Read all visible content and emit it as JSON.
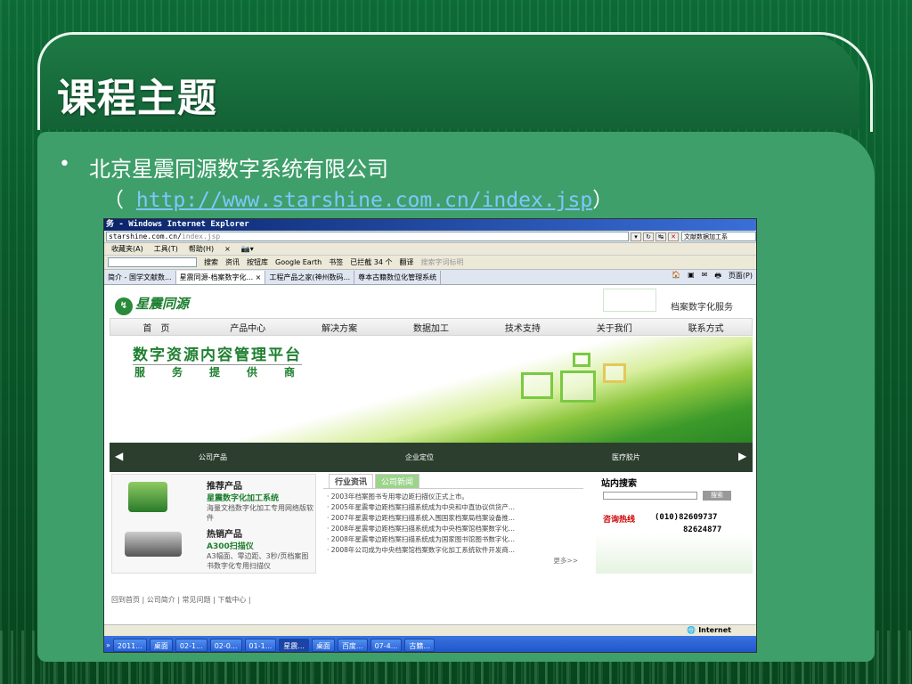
{
  "slide": {
    "title": "课程主题",
    "bullet": "•",
    "company": "北京星震同源数字系统有限公司",
    "url_open": "（",
    "url": "http://www.starshine.com.cn/index.jsp",
    "url_close": "）"
  },
  "ie": {
    "title": "务 - Windows Internet Explorer",
    "address_main": "starshine.com.cn/",
    "address_rest": "index.jsp",
    "search_placeholder": "文献数据加工系",
    "menu": [
      "收藏夹(A)",
      "工具(T)",
      "帮助(H)",
      "×",
      "📷▾"
    ],
    "tools": [
      "搜索",
      "资讯",
      "按钮库",
      "Google Earth",
      "书签",
      "已拦截 34 个",
      "翻译",
      "搜索字词标明"
    ],
    "tabs": [
      "简介 - 国学文献数...",
      "星震同源-档案数字化... ×",
      "工程产品之家(神州数码...",
      "尊本古籍数位化管理系统"
    ],
    "tabs_right": [
      "🏠",
      "▣",
      "✉",
      "🖶",
      "页面(P)"
    ]
  },
  "site": {
    "logo": "星震同源",
    "logo_mark": "↯",
    "slogan": "档案数字化服务",
    "nav": [
      "首　页",
      "产品中心",
      "解决方案",
      "数据加工",
      "技术支持",
      "关于我们",
      "联系方式"
    ],
    "banner_title": "数字资源内容管理平台",
    "banner_sub": "服务提供商",
    "slides": [
      "公司产品",
      "企业定位",
      "医疗胶片"
    ],
    "rec_title": "推荐产品",
    "rec_name": "星震数字化加工系统",
    "rec_desc": "海量文档数字化加工专用网络版软件",
    "hot_title": "热销产品",
    "hot_name": "A300扫描仪",
    "hot_desc": "A3幅面、零边距、3秒/页档案图书数字化专用扫描仪",
    "news_tabs": [
      "行业资讯",
      "公司新闻"
    ],
    "news": [
      "2003年档案图书专用零边距扫描仪正式上市。",
      "2005年星震零边距档案扫描系统成为中央和中直协议供货产...",
      "2007年星震零边距档案扫描系统入围国家档案局档案设备推...",
      "2008年星震零边距档案扫描系统成为中央档案馆档案数字化...",
      "2008年星震零边距档案扫描系统成为国家图书馆图书数字化...",
      "2008年公司成为中央档案馆档案数字化加工系统软件开发商..."
    ],
    "more": "更多>>",
    "search_title": "站内搜索",
    "search_btn": "搜索",
    "hotline_label": "咨询热线",
    "tel1": "(010)82609737",
    "tel2": "82624877",
    "footer": "回到首页 | 公司简介 | 常见问题 | 下载中心 |",
    "status_zone": "Internet"
  },
  "taskbar": [
    "»",
    "2011...",
    "桌面",
    "02-1...",
    "02-0...",
    "01-1...",
    "星震...",
    "桌面",
    "百度...",
    "07-4...",
    "古籍..."
  ]
}
